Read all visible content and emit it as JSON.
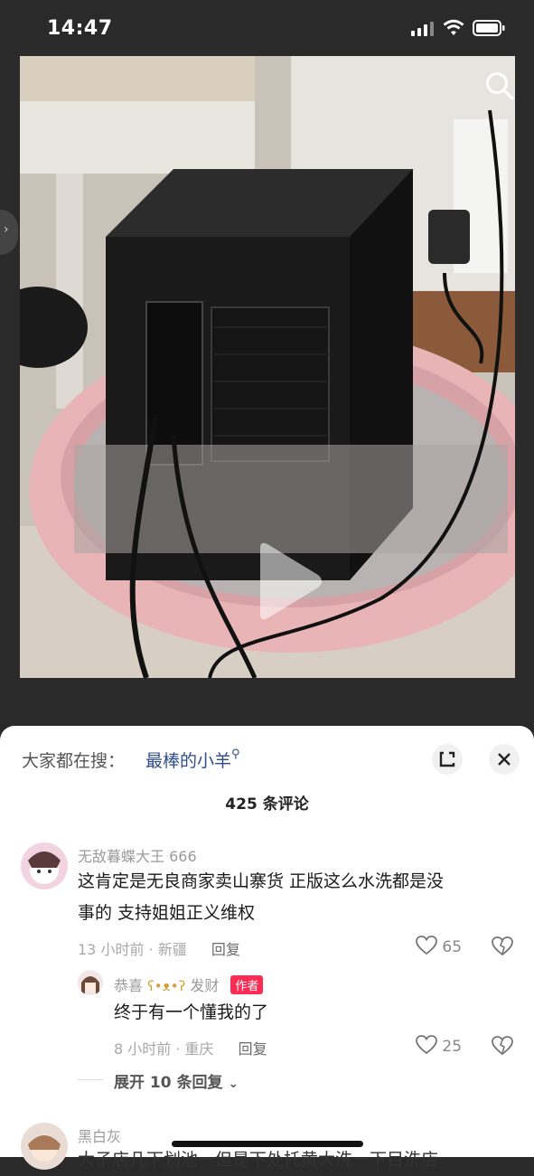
{
  "status_bar": {
    "time": "14:47"
  },
  "video": {
    "play_icon": "play-icon",
    "search_icon": "search-icon"
  },
  "panel": {
    "trending_label": "大家都在搜：",
    "trending_term": "最棒的小羊",
    "comment_count": "425 条评论",
    "comments": [
      {
        "user": "无敌暮蝶大王 666",
        "text_line1": "这肯定是无良商家卖山寨货  正版这么水洗都是没",
        "text_line2": "事的  支持姐姐正义维权",
        "meta": "13 小时前 · 新疆",
        "reply": "回复",
        "likes": "65"
      },
      {
        "user": "恭喜",
        "user_suffix": "发财",
        "badge": "作者",
        "text": "终于有一个懂我的了",
        "meta": "8 小时前 · 重庆",
        "reply": "回复",
        "likes": "25"
      }
    ],
    "expand_replies": "展开 10 条回复",
    "next_user": "黑白灰",
    "next_text_partial": "大子店几下划池一但是下处托黄大洗一下目洗店"
  },
  "colors": {
    "accent": "#fe2c55",
    "link": "#2f4d8a"
  }
}
